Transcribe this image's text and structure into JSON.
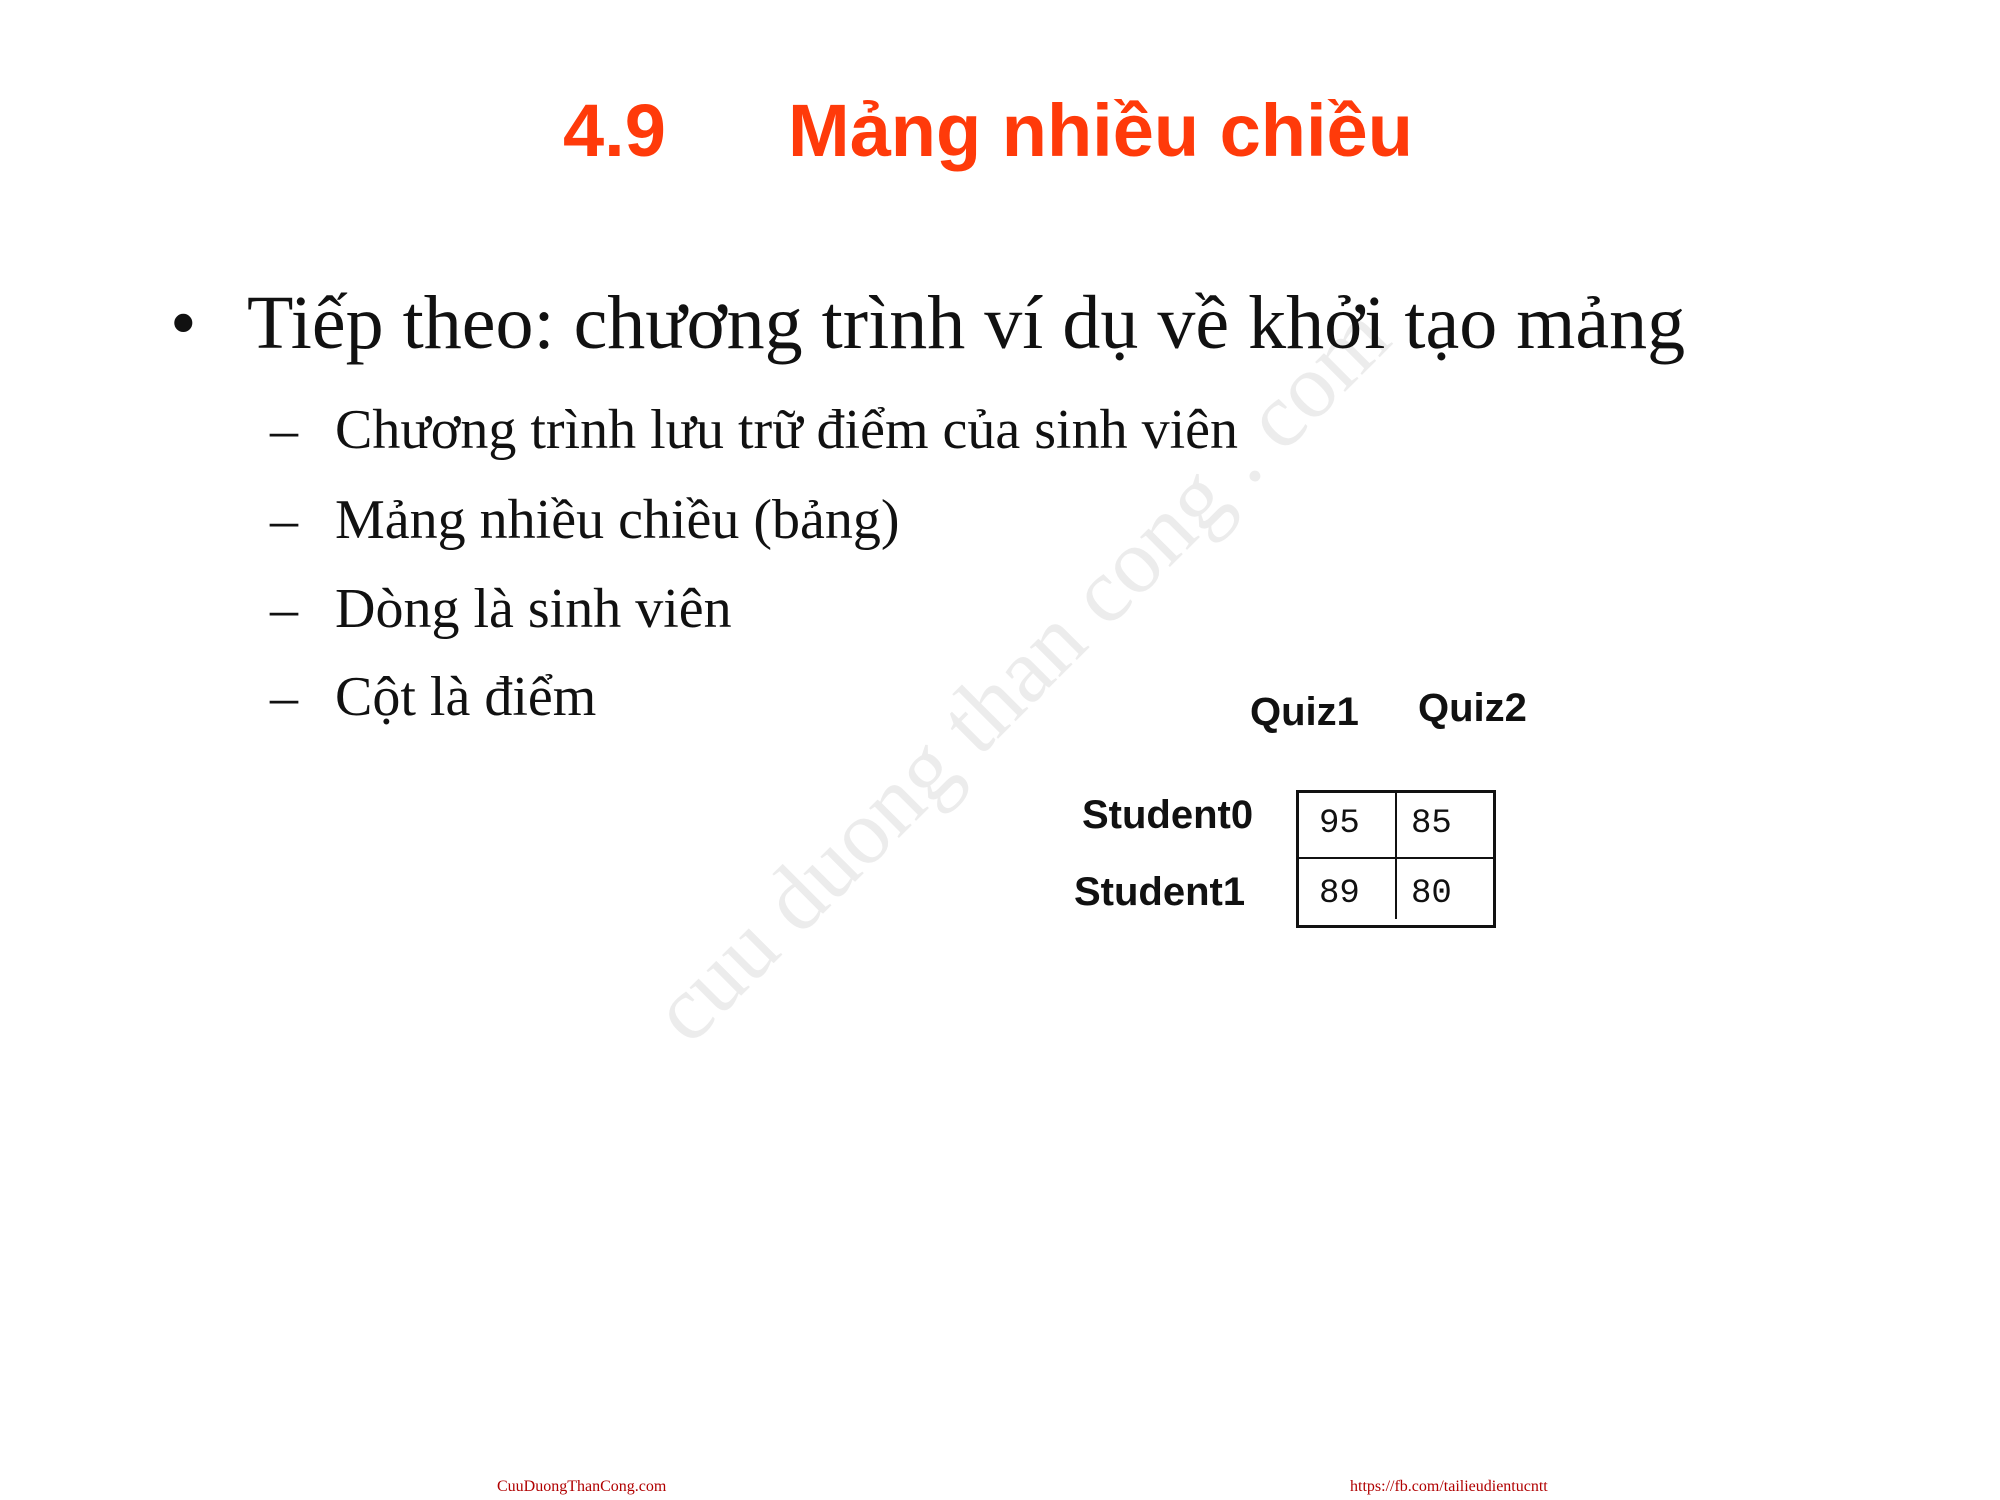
{
  "title": {
    "number": "4.9",
    "text": "Mảng nhiều chiều"
  },
  "bullet": {
    "symbol": "•",
    "text": "Tiếp theo: chương trình ví dụ về khởi tạo mảng"
  },
  "sub_items": [
    {
      "dash": "–",
      "text": "Chương trình lưu trữ điểm của sinh viên"
    },
    {
      "dash": "–",
      "text": "Mảng nhiều chiều (bảng)"
    },
    {
      "dash": "–",
      "text": "Dòng là sinh viên"
    },
    {
      "dash": "–",
      "text": "Cột là điểm"
    }
  ],
  "table": {
    "columns": [
      "Quiz1",
      "Quiz2"
    ],
    "rows": [
      {
        "label": "Student0",
        "values": [
          "95",
          "85"
        ]
      },
      {
        "label": "Student1",
        "values": [
          "89",
          "80"
        ]
      }
    ]
  },
  "watermark": "cuu duong than cong . com",
  "footer": {
    "left": "CuuDuongThanCong.com",
    "right": "https://fb.com/tailieudientucntt"
  },
  "colors": {
    "title": "#ff3a0a",
    "footer": "#b00000"
  }
}
